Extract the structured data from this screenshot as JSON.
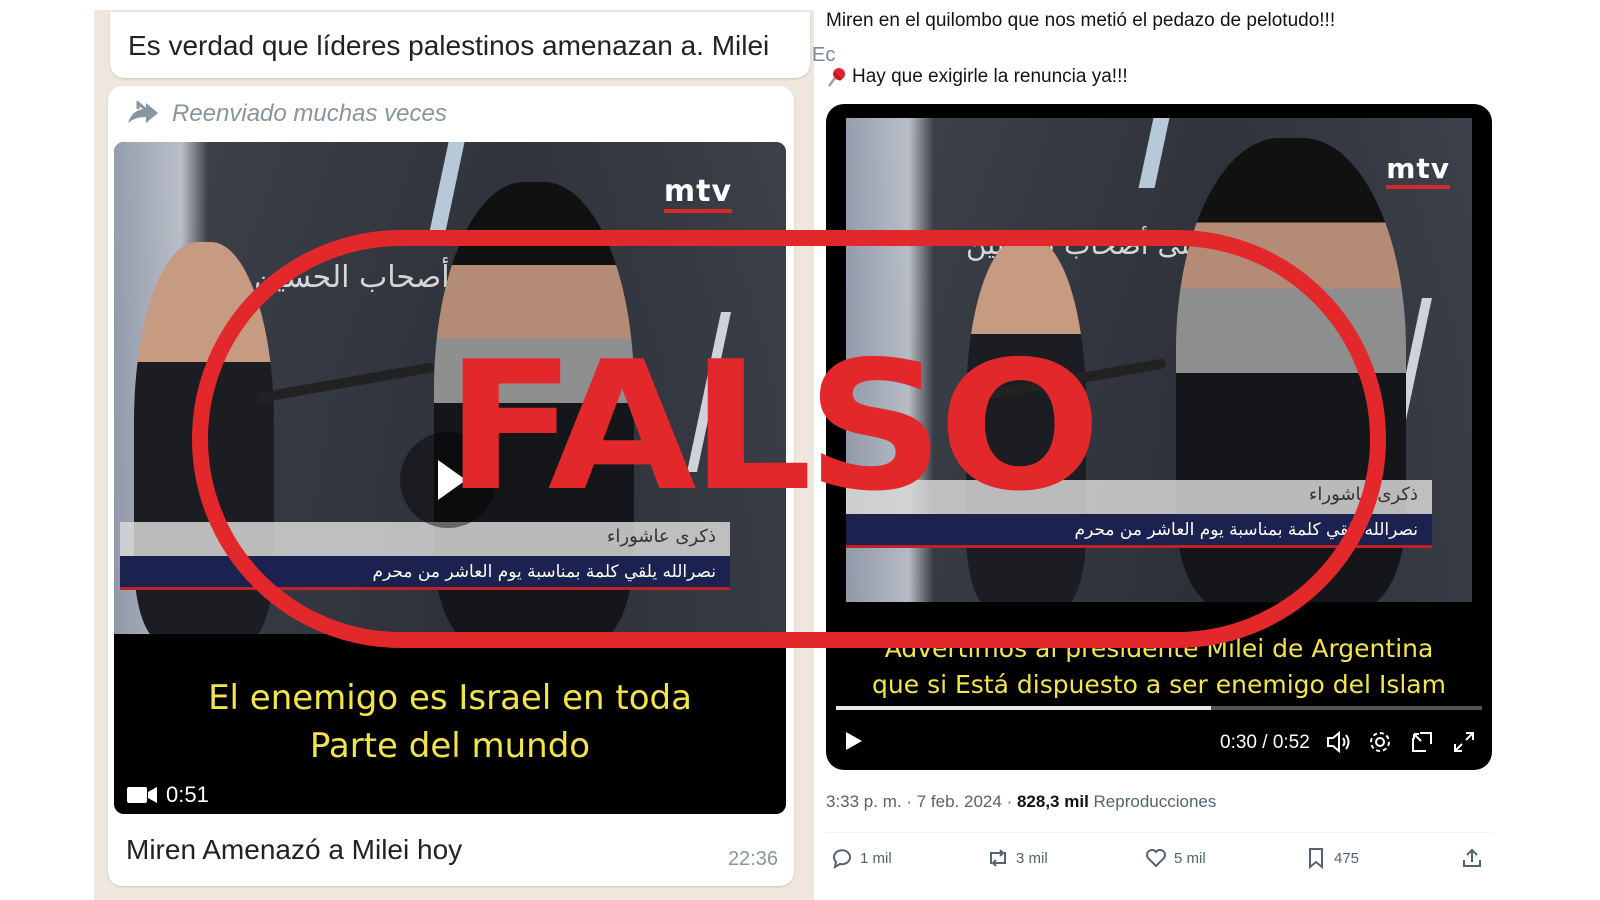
{
  "whatsapp": {
    "top_bubble_text": "Es verdad que líderes palestinos amenazan a. Milei",
    "edge_fragment": "Ec",
    "forwarded_label": "Reenviado muchas veces",
    "video": {
      "channel_logo": "mtv",
      "bg_arabic": "سين و على أصحاب الحسين",
      "lower_third_title": "ذكرى عاشوراء",
      "lower_third_text": "نصرالله يلقي كلمة بمناسبة يوم العاشر من محرم",
      "subtitle_line1": "El enemigo  es Israel en toda",
      "subtitle_line2": "Parte del mundo",
      "duration": "0:51"
    },
    "caption": "Miren Amenazó a Milei hoy",
    "time": "22:36"
  },
  "tweet": {
    "text_line1": "Miren en el quilombo que nos metió el pedazo de pelotudo!!!",
    "text_line2": "Hay que exigirle la renuncia ya!!!",
    "video": {
      "channel_logo": "mtv",
      "bg_arabic": "سين و على أصحاب الحسين",
      "lower_third_title": "ذكرى عاشوراء",
      "lower_third_text": "نصرالله يلقي كلمة بمناسبة يوم العاشر من محرم",
      "subtitle_line1": "Advertimos al presidente Milei de Argentina",
      "subtitle_line2": "que si Está dispuesto a ser enemigo del Islam",
      "time_display": "0:30 / 0:52",
      "progress": 0.58
    },
    "meta": {
      "time": "3:33 p. m.",
      "sep1": "·",
      "date": "7 feb. 2024",
      "sep2": "·",
      "views_count": "828,3 mil",
      "views_label": "Reproducciones"
    },
    "actions": {
      "replies": "1 mil",
      "reposts": "3 mil",
      "likes": "5 mil",
      "bookmarks": "475"
    }
  },
  "stamp": {
    "text": "FALSO",
    "color": "#e3282b"
  },
  "icons": [
    "forward-icon",
    "video-camera-icon",
    "play-icon",
    "pushpin-icon",
    "volume-icon",
    "settings-gear-icon",
    "pip-icon",
    "fullscreen-icon",
    "reply-icon",
    "repost-icon",
    "like-icon",
    "bookmark-icon",
    "share-icon"
  ]
}
